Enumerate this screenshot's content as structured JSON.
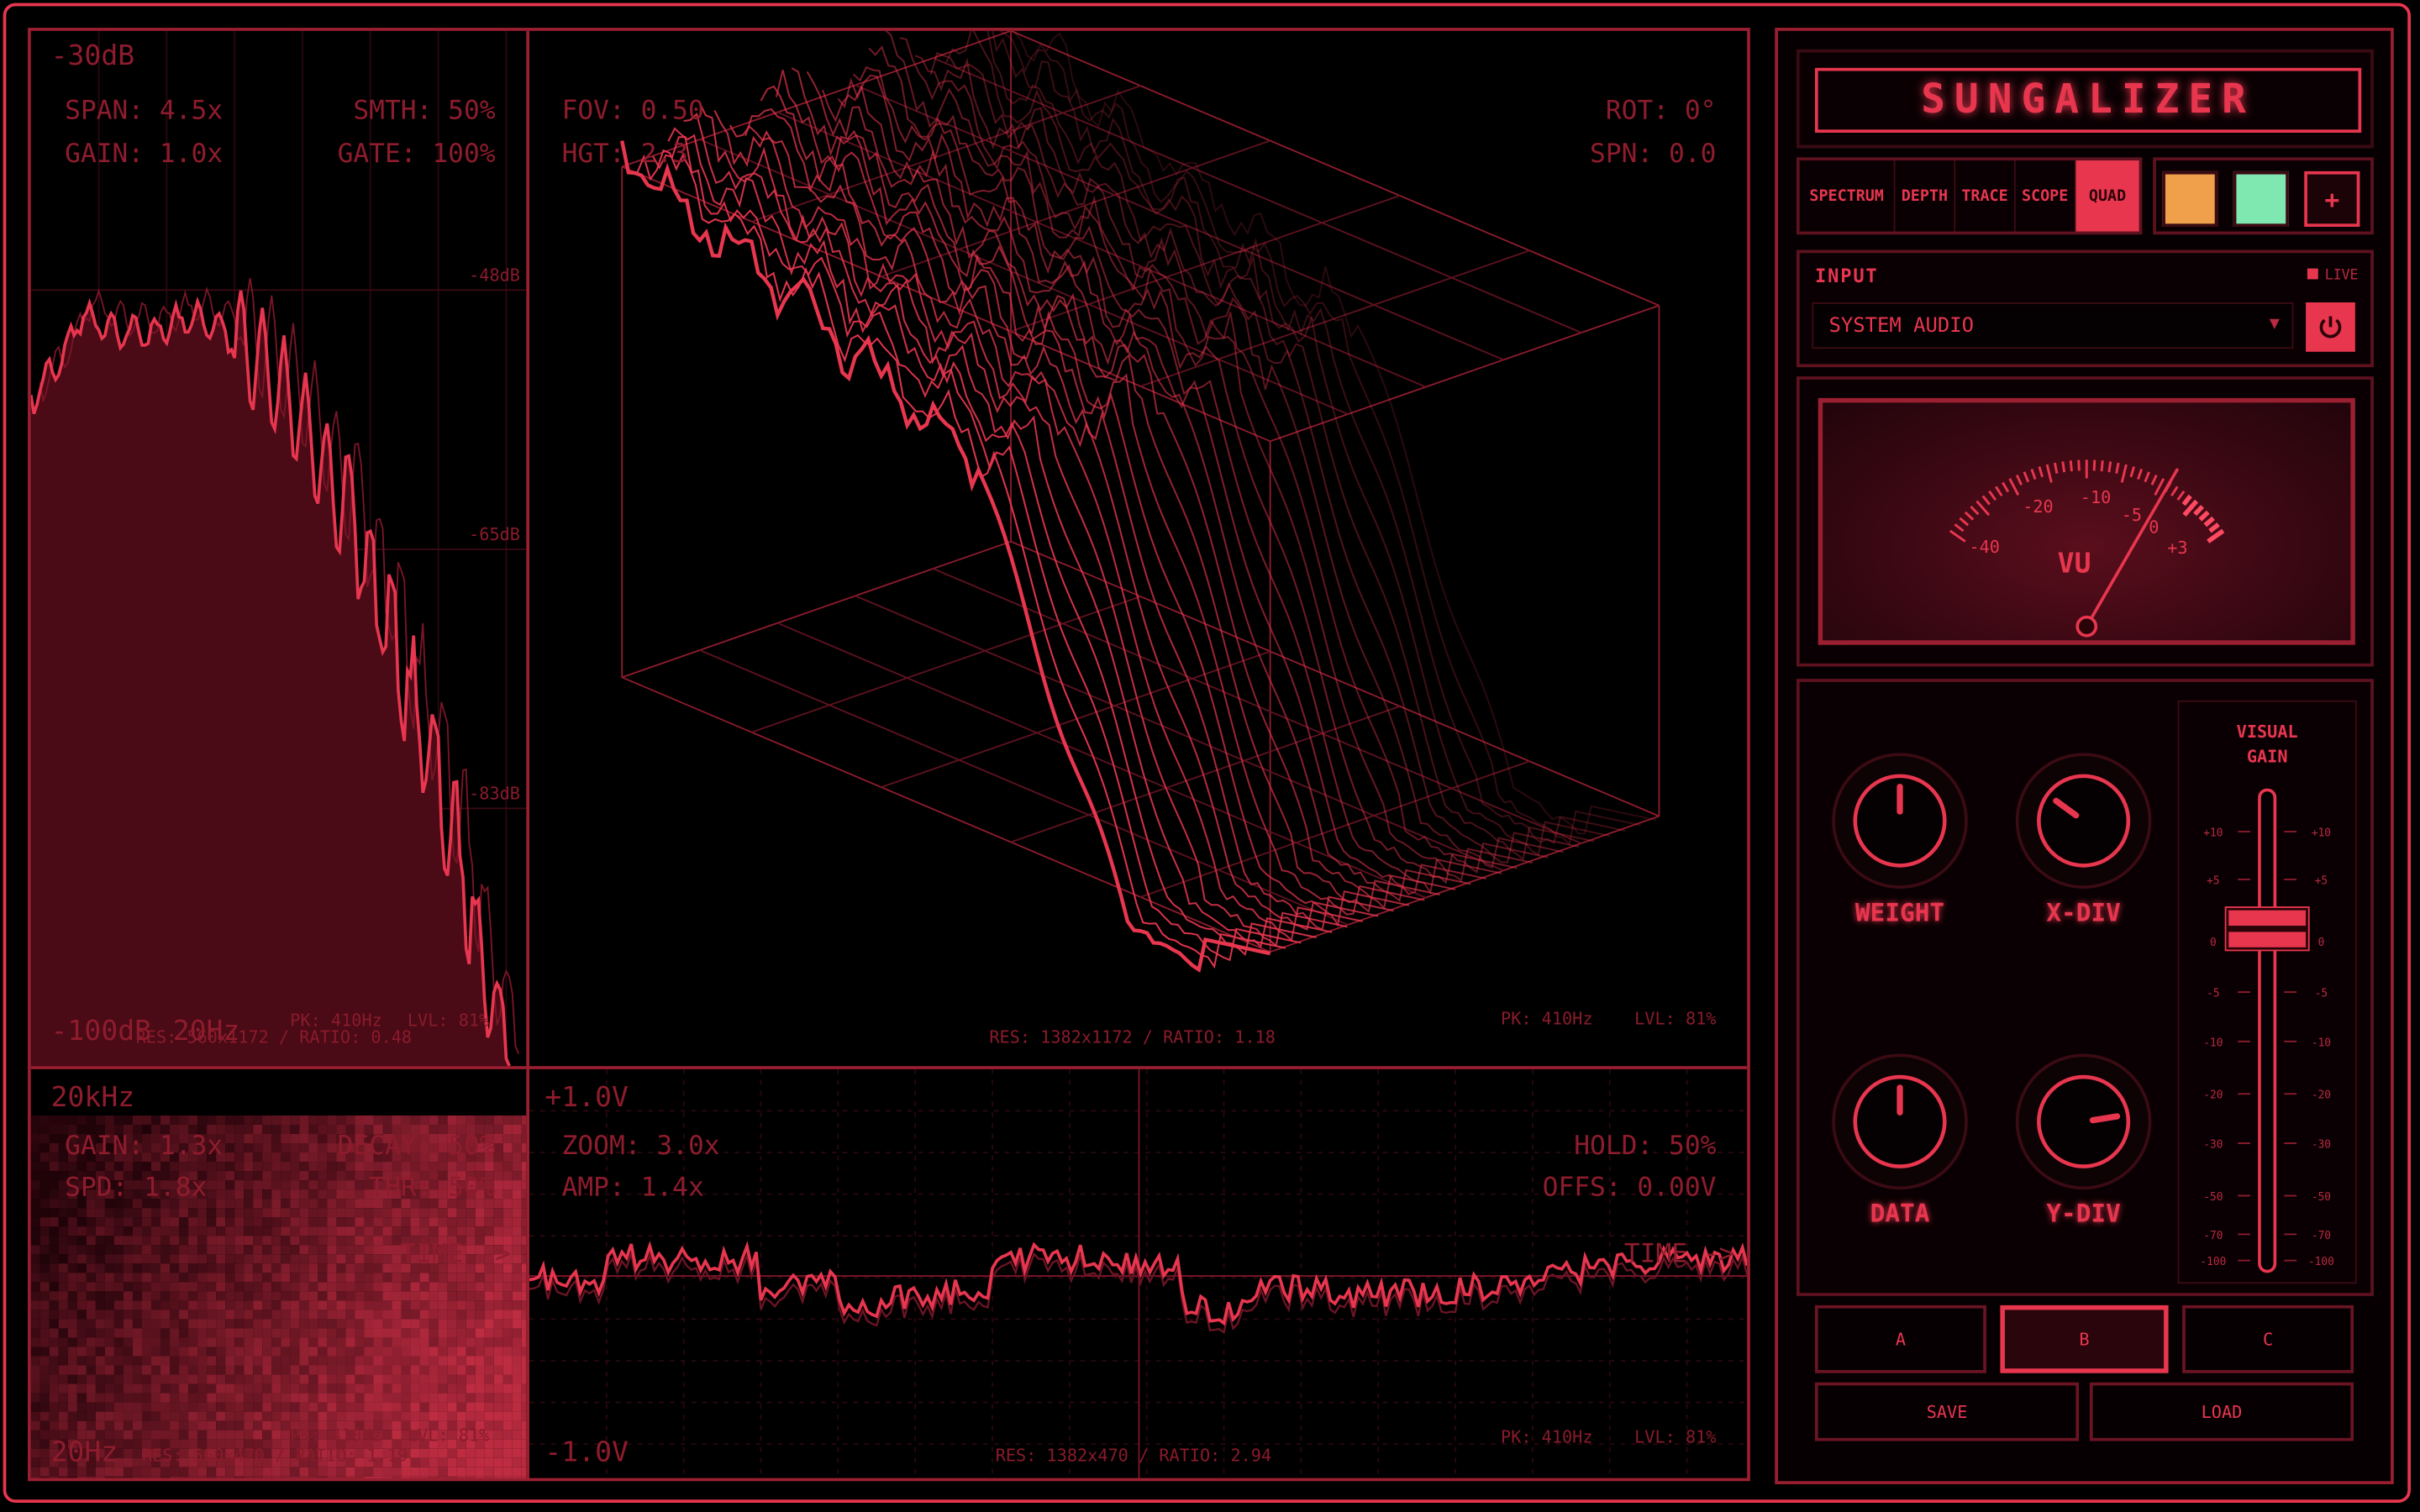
{
  "app": {
    "title": "SUNGALIZER"
  },
  "tabs": [
    {
      "label": "SPECTRUM",
      "active": false
    },
    {
      "label": "DEPTH",
      "active": false
    },
    {
      "label": "TRACE",
      "active": false
    },
    {
      "label": "SCOPE",
      "active": false
    },
    {
      "label": "QUAD",
      "active": true
    }
  ],
  "colors": {
    "accent": "#e8364f",
    "swatch_orange": "#f0a04b",
    "swatch_green": "#7ee8b0",
    "swatch_red": "#e8364f"
  },
  "swatch_add_label": "+",
  "input": {
    "label": "INPUT",
    "live_label": "LIVE",
    "source": "SYSTEM AUDIO",
    "dropdown_icon": "chevron-down-icon",
    "power_icon": "power-icon"
  },
  "vu": {
    "title": "VU",
    "scale": [
      "-40",
      "-20",
      "-10",
      "-5",
      "0",
      "+3"
    ]
  },
  "knobs": [
    {
      "label": "WEIGHT",
      "value": 0.5
    },
    {
      "label": "X-DIV",
      "value": 0.3
    },
    {
      "label": "DATA",
      "value": 0.5
    },
    {
      "label": "Y-DIV",
      "value": 0.8
    }
  ],
  "fader": {
    "label_line1": "VISUAL",
    "label_line2": "GAIN",
    "scale": [
      "+10",
      "+5",
      "0",
      "-5",
      "-10",
      "-20",
      "-30",
      "-50",
      "-70",
      "-100"
    ]
  },
  "presets": {
    "buttons": [
      "A",
      "B",
      "C"
    ],
    "selected": "B",
    "save_label": "SAVE",
    "load_label": "LOAD"
  },
  "panes": {
    "spectrum": {
      "top_db": "-30dB",
      "bottom_db": "-100dB",
      "freq": "20Hz",
      "span": "SPAN: 4.5x",
      "smth": "SMTH: 50%",
      "gain": "GAIN: 1.0x",
      "gate": "GATE: 100%",
      "grid_db": [
        "-48dB",
        "-65dB",
        "-83dB"
      ],
      "res": "RES: 560x1172 / RATIO: 0.48",
      "pk": "PK: 410Hz",
      "lvl": "LVL: 81%"
    },
    "depth": {
      "fov": "FOV: 0.50",
      "hgt": "HGT: 2.3",
      "rot": "ROT: 0°",
      "spn": "SPN: 0.0",
      "res": "RES: 1382x1172 / RATIO: 1.18",
      "pk": "PK: 410Hz",
      "lvl": "LVL: 81%"
    },
    "trace": {
      "top_freq": "20kHz",
      "bottom_freq": "20Hz",
      "gain": "GAIN: 1.3x",
      "decay": "DECAY: 50%",
      "spd": "SPD: 1.8x",
      "thr": "THR: 50%",
      "time": "TIME ->",
      "res": "RES: 560x470 / RATIO: 1.19",
      "pk": "PK: 410Hz",
      "lvl": "LVL: 81%"
    },
    "scope": {
      "top_v": "+1.0V",
      "bottom_v": "-1.0V",
      "zoom": "ZOOM: 3.0x",
      "amp": "AMP: 1.4x",
      "hold": "HOLD: 50%",
      "offs": "OFFS: 0.00V",
      "time": "TIME ->",
      "res": "RES: 1382x470 / RATIO: 2.94",
      "pk": "PK: 410Hz",
      "lvl": "LVL: 81%"
    }
  }
}
